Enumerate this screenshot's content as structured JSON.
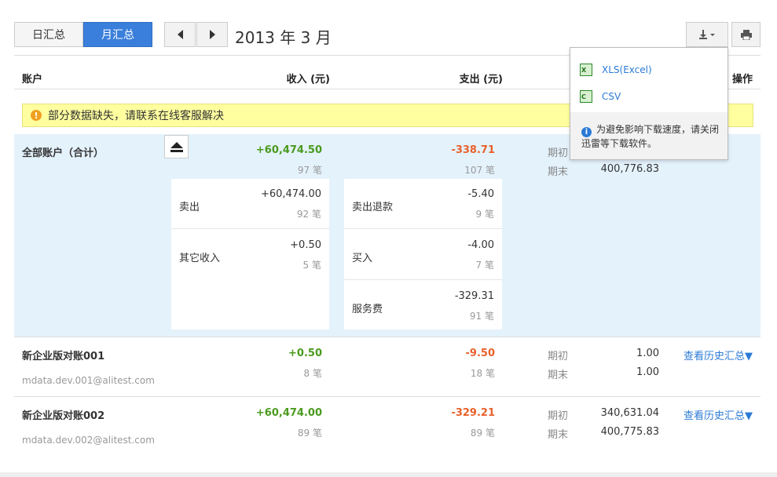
{
  "toolbar": {
    "tab_day": "日汇总",
    "tab_month": "月汇总",
    "period": "2013 年 3 月"
  },
  "table_header": {
    "account": "账户",
    "income": "收入 (元)",
    "expense": "支出 (元)",
    "action": "操作"
  },
  "alert": {
    "text": "部分数据缺失，请联系在线客服解决"
  },
  "total": {
    "name": "全部账户（合计）",
    "income": "+60,474.50",
    "income_count": "97 笔",
    "expense": "-338.71",
    "expense_count": "107 笔",
    "begin_label": "期初",
    "end_label": "期末",
    "end_value": "400,776.83",
    "income_items": [
      {
        "label": "卖出",
        "amount": "+60,474.00",
        "count": "92 笔"
      },
      {
        "label": "其它收入",
        "amount": "+0.50",
        "count": "5 笔"
      }
    ],
    "expense_items": [
      {
        "label": "卖出退款",
        "amount": "-5.40",
        "count": "9 笔"
      },
      {
        "label": "买入",
        "amount": "-4.00",
        "count": "7 笔"
      },
      {
        "label": "服务费",
        "amount": "-329.31",
        "count": "91 笔"
      }
    ]
  },
  "accounts": [
    {
      "name": "新企业版对账001",
      "email": "mdata.dev.001@alitest.com",
      "income": "+0.50",
      "income_count": "8 笔",
      "expense": "-9.50",
      "expense_count": "18 笔",
      "begin_label": "期初",
      "begin_value": "1.00",
      "end_label": "期末",
      "end_value": "1.00",
      "history_link": "查看历史汇总▼"
    },
    {
      "name": "新企业版对账002",
      "email": "mdata.dev.002@alitest.com",
      "income": "+60,474.00",
      "income_count": "89 笔",
      "expense": "-329.21",
      "expense_count": "89 笔",
      "begin_label": "期初",
      "begin_value": "340,631.04",
      "end_label": "期末",
      "end_value": "400,775.83",
      "history_link": "查看历史汇总▼"
    }
  ],
  "download_menu": {
    "xls": "XLS(Excel)",
    "csv": "CSV",
    "note": "为避免影响下载速度，请关闭迅雷等下载软件。"
  },
  "colors": {
    "accent": "#3a7fdb",
    "income": "#4a9a1e",
    "expense": "#e8612c",
    "alert_bg": "#ffffa0",
    "total_bg": "#e4f2fc",
    "link": "#2b7bd6"
  },
  "icons": [
    "chevron-left-icon",
    "chevron-right-icon",
    "download-icon",
    "print-icon",
    "warning-icon",
    "collapse-icon",
    "excel-file-icon",
    "csv-file-icon",
    "info-icon"
  ]
}
